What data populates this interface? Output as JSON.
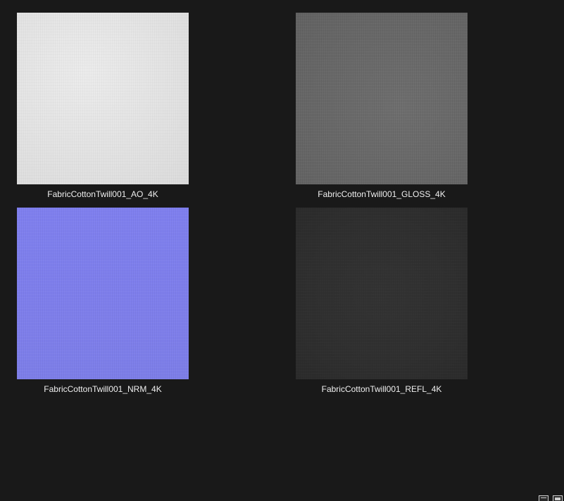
{
  "files": [
    {
      "name": "FabricCottonTwill001_AO_4K",
      "map": "ao",
      "swatch_color": "#e4e4e4"
    },
    {
      "name": "FabricCottonTwill001_GLOSS_4K",
      "map": "gloss",
      "swatch_color": "#686868"
    },
    {
      "name": "FabricCottonTwill001_NRM_4K",
      "map": "nrm",
      "swatch_color": "#7e7eec"
    },
    {
      "name": "FabricCottonTwill001_REFL_4K",
      "map": "refl",
      "swatch_color": "#303030"
    }
  ],
  "status_bar": {
    "icons": [
      "details-view-icon",
      "large-icons-view-icon"
    ]
  },
  "colors": {
    "background": "#191919",
    "label_text": "#f0f0f0"
  }
}
